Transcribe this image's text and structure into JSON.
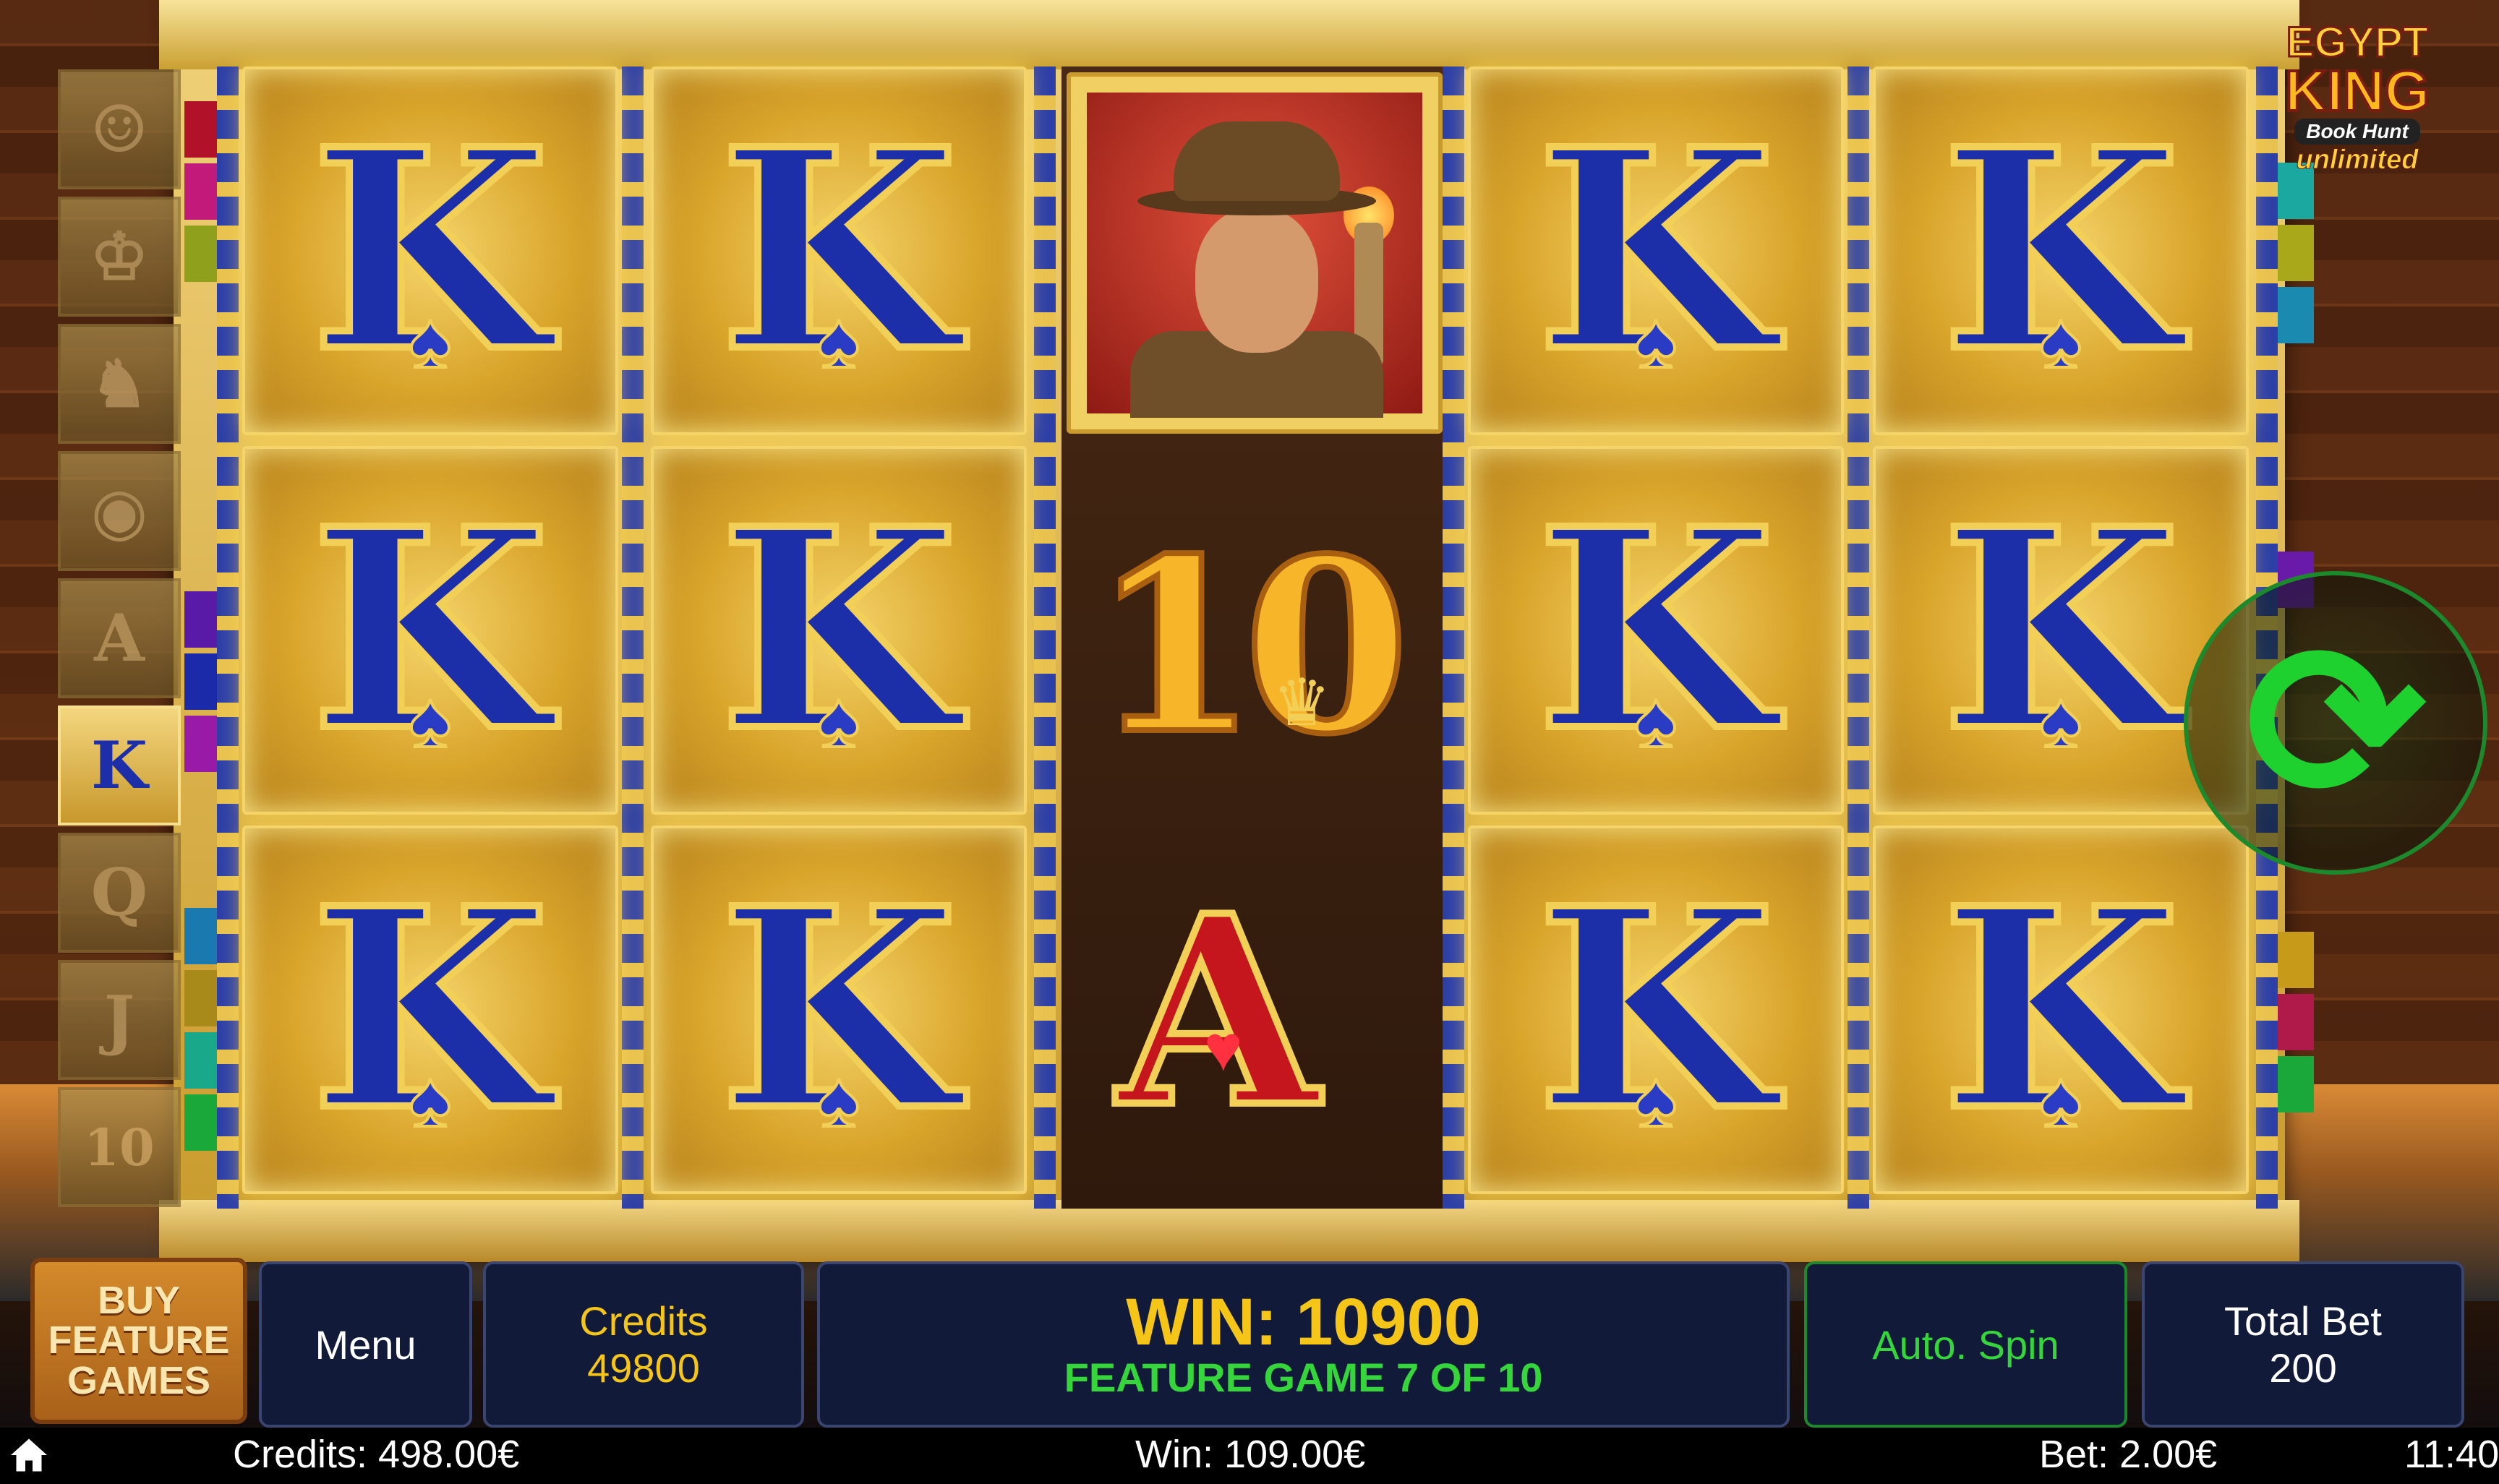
{
  "logo": {
    "line1": "EGYPT",
    "line2": "KING",
    "line3": "Book Hunt",
    "line4": "unlimited"
  },
  "paytable": [
    "person",
    "pharaoh",
    "anubis",
    "eye",
    "A",
    "K",
    "Q",
    "J",
    "10"
  ],
  "reels": {
    "col1": [
      "K",
      "K",
      "K"
    ],
    "col2": [
      "K",
      "K",
      "K"
    ],
    "col3": [
      "explorer",
      "10",
      "A"
    ],
    "col4": [
      "K",
      "K",
      "K"
    ],
    "col5": [
      "K",
      "K",
      "K"
    ]
  },
  "symbols": {
    "k": "K",
    "ten": "10",
    "a": "A",
    "spade": "♠",
    "heart": "♥",
    "crown": "♛"
  },
  "controls": {
    "buy_feature": "BUY FEATURE GAMES",
    "menu": "Menu",
    "credits_label": "Credits",
    "credits_value": "49800",
    "win_text": "WIN: 10900",
    "feature_text": "FEATURE GAME 7 OF 10",
    "autospin": "Auto. Spin",
    "total_bet_label": "Total Bet",
    "total_bet_value": "200"
  },
  "status": {
    "credits": "Credits: 498.00€",
    "win": "Win: 109.00€",
    "bet": "Bet: 2.00€",
    "time": "11:40"
  },
  "colors": {
    "k_blue": "#1d2fa8",
    "gold": "#f5c518",
    "green": "#34d63c",
    "panel": "#121a3a"
  },
  "icons": {
    "spin": "refresh-arrows-icon",
    "home": "home-icon"
  }
}
